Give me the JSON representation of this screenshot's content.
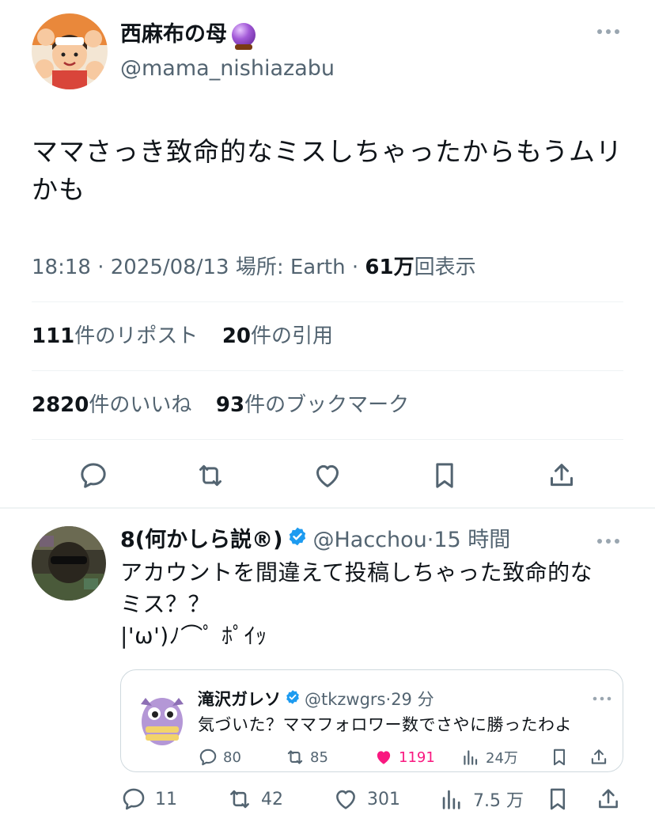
{
  "tweet": {
    "author_name": "西麻布の母",
    "author_handle": "@mama_nishiazabu",
    "text": "ママさっき致命的なミスしちゃったからもうムリかも",
    "time": "18:18",
    "date": "2025/08/13",
    "location": "場所: Earth",
    "views_value": "61万",
    "views_label": "回表示",
    "reposts_value": "111",
    "reposts_label": "件のリポスト",
    "quotes_value": "20",
    "quotes_label": "件の引用",
    "likes_value": "2820",
    "likes_label": "件のいいね",
    "bookmarks_value": "93",
    "bookmarks_label": "件のブックマーク"
  },
  "reply": {
    "author_name": "8(何かしら説®)",
    "author_handle": "@Hacchou",
    "time_ago": "15 時間",
    "text_line1": "アカウントを間違えて投稿しちゃった致命的な",
    "text_line2": "ミス？？",
    "text_line3": "|'ω')ﾉ⌒ﾟ ﾎﾟｲｯ",
    "replies": "11",
    "reposts": "42",
    "likes": "301",
    "views": "7.5 万",
    "quote": {
      "author_name": "滝沢ガレソ",
      "author_handle": "@tkzwgrs",
      "time_ago": "29 分",
      "text": "気づいた？ママフォロワー数でさやに勝ったわよ",
      "replies": "80",
      "reposts": "85",
      "likes": "1191",
      "views": "24万"
    }
  },
  "colors": {
    "text": "#0f1419",
    "muted": "#536471",
    "divider": "#eff3f4",
    "verified": "#1d9bf0",
    "like": "#f91880"
  }
}
